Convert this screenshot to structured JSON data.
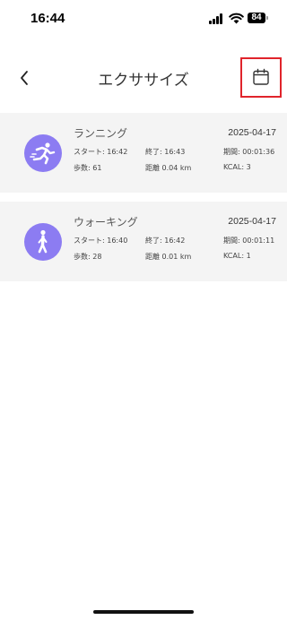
{
  "status": {
    "time": "16:44",
    "battery": "84"
  },
  "nav": {
    "title": "エクササイズ"
  },
  "icons": {
    "back": "chevron-left-icon",
    "calendar": "calendar-icon",
    "running": "running-person-icon",
    "walking": "walking-person-icon"
  },
  "colors": {
    "accent": "#8c7cf2",
    "highlight_border": "#e0242b",
    "card_bg": "#f4f4f4"
  },
  "records": [
    {
      "name": "ランニング",
      "date": "2025-04-17",
      "start": "スタート: 16:42",
      "end": "終了: 16:43",
      "duration": "期間: 00:01:36",
      "steps": "歩数: 61",
      "distance": "距離 0.04 km",
      "kcal": "KCAL: 3"
    },
    {
      "name": "ウォーキング",
      "date": "2025-04-17",
      "start": "スタート: 16:40",
      "end": "終了: 16:42",
      "duration": "期間: 00:01:11",
      "steps": "歩数: 28",
      "distance": "距離 0.01 km",
      "kcal": "KCAL: 1"
    }
  ]
}
